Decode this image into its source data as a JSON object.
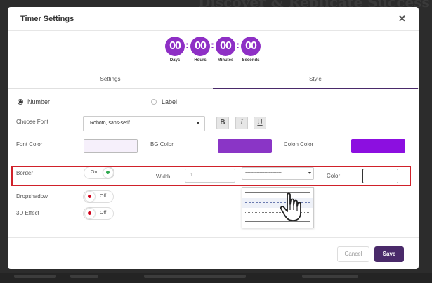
{
  "background": {
    "heading": "Discover & Replicate Success"
  },
  "modal": {
    "title": "Timer Settings",
    "close_icon": "close-icon"
  },
  "timer": {
    "color": "#8e2fc5",
    "units": [
      {
        "value": "00",
        "label": "Days"
      },
      {
        "value": "00",
        "label": "Hours"
      },
      {
        "value": "00",
        "label": "Minutes"
      },
      {
        "value": "00",
        "label": "Seconds"
      }
    ],
    "separator": ":"
  },
  "tabs": [
    {
      "label": "Settings",
      "active": false
    },
    {
      "label": "Style",
      "active": true
    }
  ],
  "style": {
    "display_mode": {
      "number_label": "Number",
      "label_label": "Label",
      "selected": "Number"
    },
    "font": {
      "label": "Choose Font",
      "value": "Roboto, sans-serif"
    },
    "format_buttons": {
      "bold": "B",
      "italic": "I",
      "underline": "U"
    },
    "font_color": {
      "label": "Font Color",
      "value": "#f6f0fb"
    },
    "bg_color": {
      "label": "BG Color",
      "value": "#8a35c6"
    },
    "colon_color": {
      "label": "Colon Color",
      "value": "#8c0fe0"
    },
    "border": {
      "label": "Border",
      "toggle_text": "On",
      "enabled": true,
      "width_label": "Width",
      "width_value": "1",
      "style_value": "----------------------------",
      "color_label": "Color",
      "color_value": "#ffffff",
      "style_options": [
        "solid",
        "dashed",
        "dotted",
        "double"
      ]
    },
    "dropshadow": {
      "label": "Dropshadow",
      "toggle_text": "Off",
      "enabled": false
    },
    "effect_3d": {
      "label": "3D Effect",
      "toggle_text": "Off",
      "enabled": false
    }
  },
  "footer": {
    "cancel_label": "Cancel",
    "save_label": "Save",
    "save_color": "#4a2a6a"
  },
  "accent": {
    "highlight": "#d0212a"
  }
}
